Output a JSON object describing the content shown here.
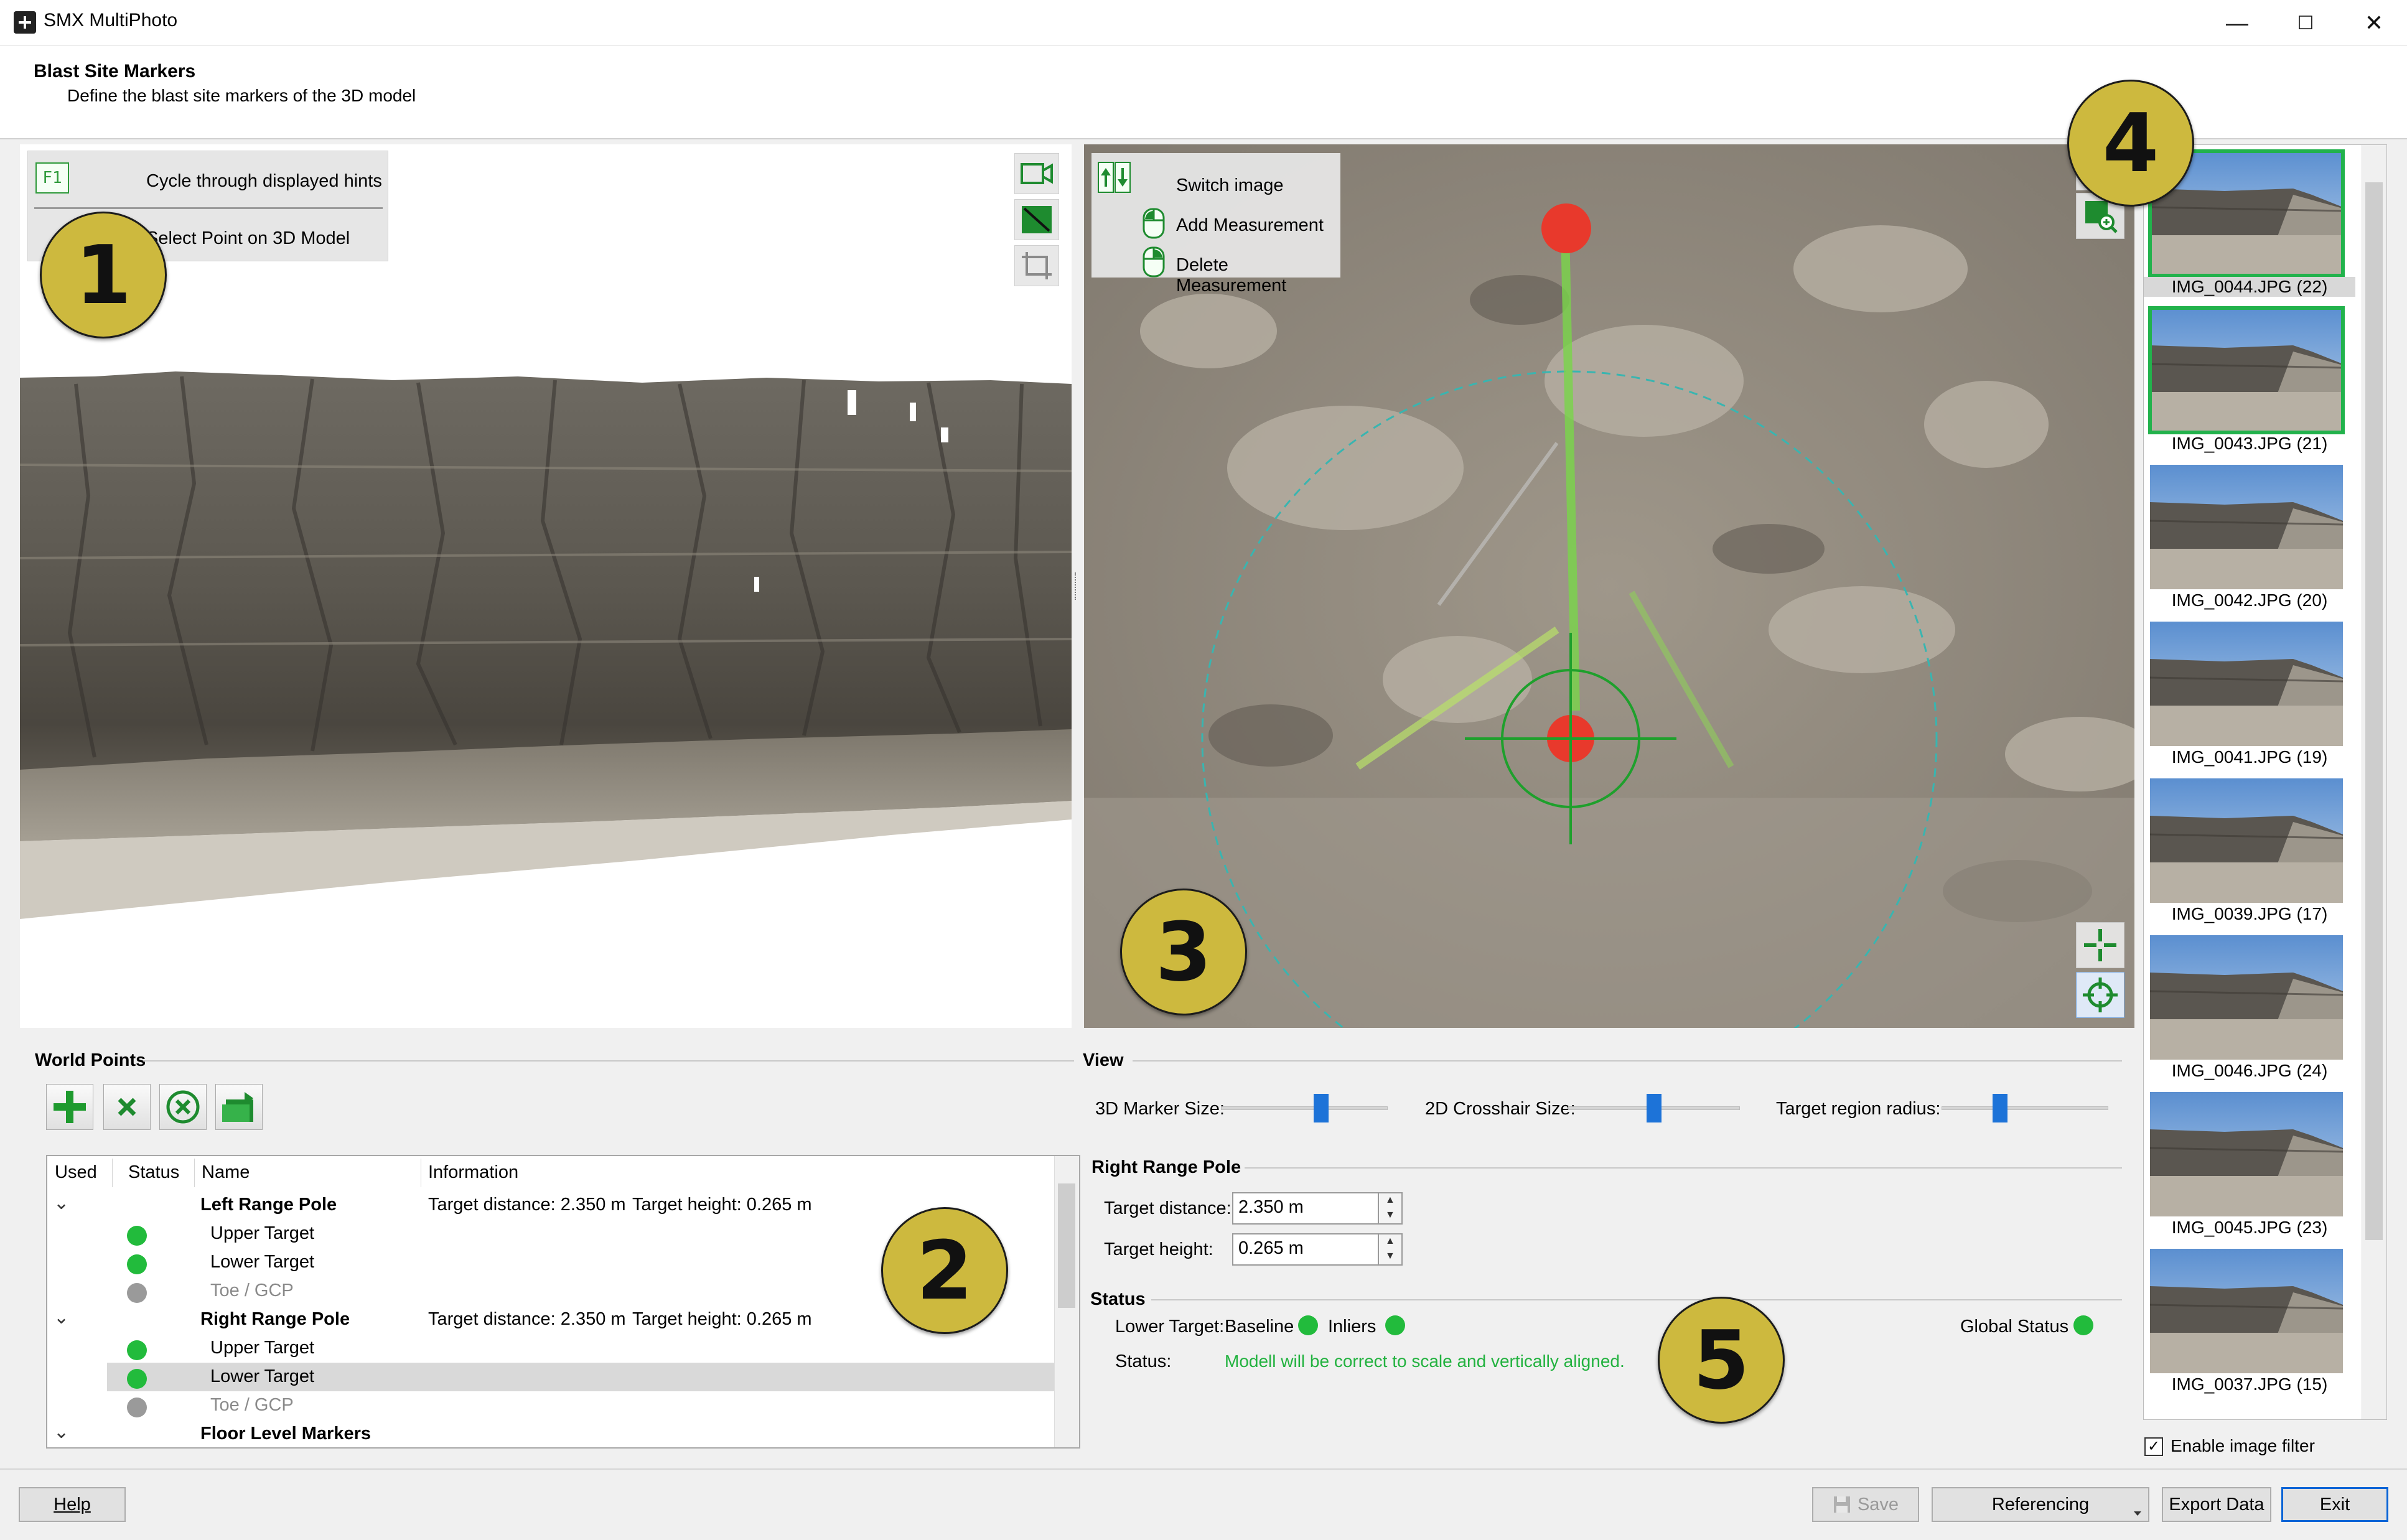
{
  "app": {
    "title": "SMX MultiPhoto",
    "icon": "app-logo-icon"
  },
  "window_controls": {
    "minimize": "—",
    "maximize": "☐",
    "close": "✕"
  },
  "header": {
    "title": "Blast Site Markers",
    "subtitle": "Define the blast site markers of the 3D model"
  },
  "view3d": {
    "hint_key": "F1",
    "hints": [
      "Cycle through displayed hints",
      "Select Point on 3D Model"
    ],
    "tools": [
      "camera-icon",
      "texture-toggle-icon",
      "crop-frame-icon"
    ]
  },
  "view2d": {
    "hints": [
      "Switch image",
      "Add Measurement",
      "Delete Measurement"
    ],
    "tools": [
      "zoom-fit-icon",
      "zoom-image-icon",
      "add-crosshair-icon",
      "center-target-icon"
    ]
  },
  "thumbnails": [
    {
      "label": "IMG_0044.JPG (22)",
      "selected": true,
      "current": true
    },
    {
      "label": "IMG_0043.JPG (21)",
      "selected": true,
      "current": false
    },
    {
      "label": "IMG_0042.JPG (20)",
      "selected": false,
      "current": false
    },
    {
      "label": "IMG_0041.JPG (19)",
      "selected": false,
      "current": false
    },
    {
      "label": "IMG_0039.JPG (17)",
      "selected": false,
      "current": false
    },
    {
      "label": "IMG_0046.JPG (24)",
      "selected": false,
      "current": false
    },
    {
      "label": "IMG_0045.JPG (23)",
      "selected": false,
      "current": false
    },
    {
      "label": "IMG_0037.JPG (15)",
      "selected": false,
      "current": false
    }
  ],
  "image_filter": {
    "label": "Enable image filter",
    "checked": true,
    "check_glyph": "✓"
  },
  "world_points": {
    "title": "World Points",
    "toolbar": [
      "add-icon",
      "delete-icon",
      "clear-icon",
      "import-icon"
    ],
    "columns": [
      "Used",
      "Status",
      "Name",
      "Information"
    ],
    "groups": [
      {
        "name": "Left Range Pole",
        "info_distance": "Target distance: 2.350 m",
        "info_height": "Target height: 0.265 m",
        "children": [
          {
            "name": "Upper Target",
            "status": "green"
          },
          {
            "name": "Lower Target",
            "status": "green"
          },
          {
            "name": "Toe / GCP",
            "status": "grey"
          }
        ]
      },
      {
        "name": "Right Range Pole",
        "info_distance": "Target distance: 2.350 m",
        "info_height": "Target height: 0.265 m",
        "children": [
          {
            "name": "Upper Target",
            "status": "green"
          },
          {
            "name": "Lower Target",
            "status": "green",
            "selected": true
          },
          {
            "name": "Toe / GCP",
            "status": "grey"
          }
        ]
      },
      {
        "name": "Floor Level Markers",
        "children": []
      }
    ],
    "expand_glyph": "⌄"
  },
  "view": {
    "title": "View",
    "sliders": [
      {
        "label": "3D Marker Size:",
        "value": 0.6
      },
      {
        "label": "2D Crosshair Size:",
        "value": 0.5
      },
      {
        "label": "Target region radius:",
        "value": 0.35
      }
    ]
  },
  "pole": {
    "title": "Right Range Pole",
    "distance_label": "Target distance:",
    "distance_value": "2.350 m",
    "height_label": "Target height:",
    "height_value": "0.265 m"
  },
  "status": {
    "title": "Status",
    "lower_target_label": "Lower Target:",
    "baseline_label": "Baseline",
    "inliers_label": "Inliers",
    "global_label": "Global Status",
    "status_label": "Status:",
    "message": "Modell will be correct to scale and vertically aligned."
  },
  "buttons": {
    "help": "Help",
    "save": "Save",
    "referencing": "Referencing",
    "export": "Export Data",
    "exit": "Exit"
  },
  "badges": [
    "1",
    "2",
    "3",
    "4",
    "5"
  ],
  "colors": {
    "accent_green": "#22b24c",
    "status_green": "#22bb3c",
    "status_grey": "#9a9a9a",
    "slider_blue": "#1d73d8",
    "badge_gold": "#cdb93e",
    "marker_red": "#e8392c"
  }
}
